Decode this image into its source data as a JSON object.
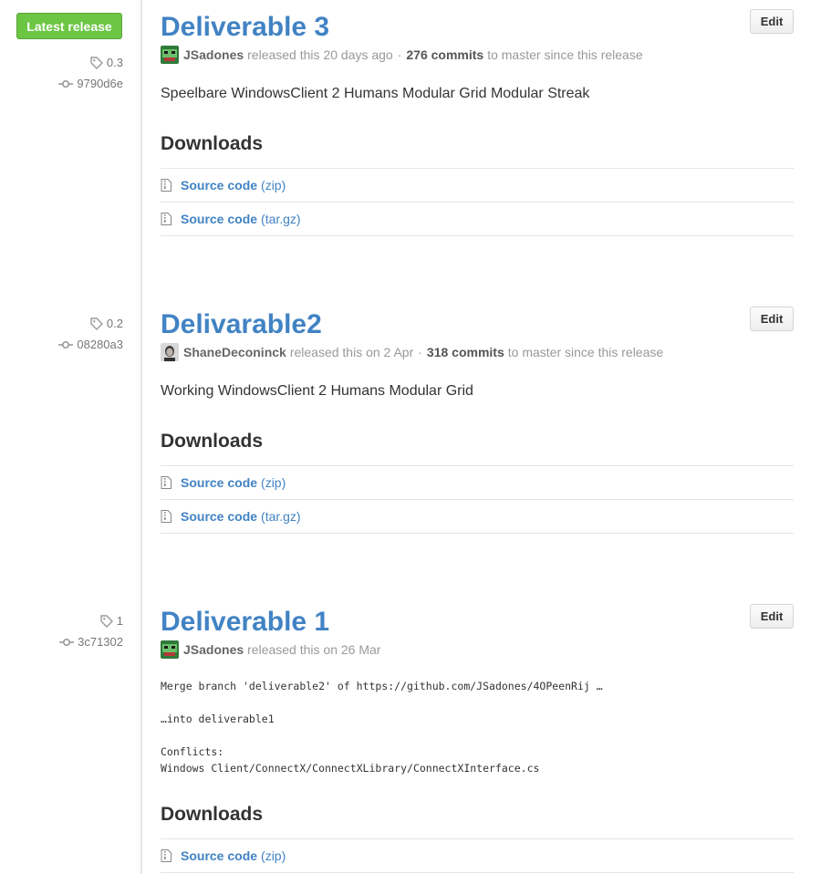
{
  "latest_badge": "Latest release",
  "releases": [
    {
      "tag": "0.3",
      "commit": "9790d6e",
      "title": "Deliverable 3",
      "edit_label": "Edit",
      "author": "JSadones",
      "released_text": "released this 20 days ago",
      "separator": "·",
      "commits_count": "276 commits",
      "commits_suffix": "to master since this release",
      "description": "Speelbare WindowsClient 2 Humans Modular Grid Modular Streak",
      "downloads_heading": "Downloads",
      "downloads": [
        {
          "label": "Source code",
          "ext": "(zip)"
        },
        {
          "label": "Source code",
          "ext": "(tar.gz)"
        }
      ]
    },
    {
      "tag": "0.2",
      "commit": "08280a3",
      "title": "Delivarable2",
      "edit_label": "Edit",
      "author": "ShaneDeconinck",
      "released_text": "released this on 2 Apr",
      "separator": "·",
      "commits_count": "318 commits",
      "commits_suffix": "to master since this release",
      "description": "Working WindowsClient 2 Humans Modular Grid",
      "downloads_heading": "Downloads",
      "downloads": [
        {
          "label": "Source code",
          "ext": "(zip)"
        },
        {
          "label": "Source code",
          "ext": "(tar.gz)"
        }
      ]
    },
    {
      "tag": "1",
      "commit": "3c71302",
      "title": "Deliverable 1",
      "edit_label": "Edit",
      "author": "JSadones",
      "released_text": "released this on 26 Mar",
      "description_lines": [
        "Merge branch 'deliverable2' of https://github.com/JSadones/4OPeenRij …",
        "",
        "…into deliverable1",
        "",
        "Conflicts:",
        "Windows Client/ConnectX/ConnectXLibrary/ConnectXInterface.cs"
      ],
      "downloads_heading": "Downloads",
      "downloads": [
        {
          "label": "Source code",
          "ext": "(zip)"
        }
      ]
    }
  ],
  "icons": {
    "tag": "tag-icon",
    "commit": "commit-icon",
    "zip": "file-zip-icon"
  },
  "colors": {
    "link": "#4183c4",
    "latest_badge": "#6cc644",
    "muted": "#999999"
  }
}
